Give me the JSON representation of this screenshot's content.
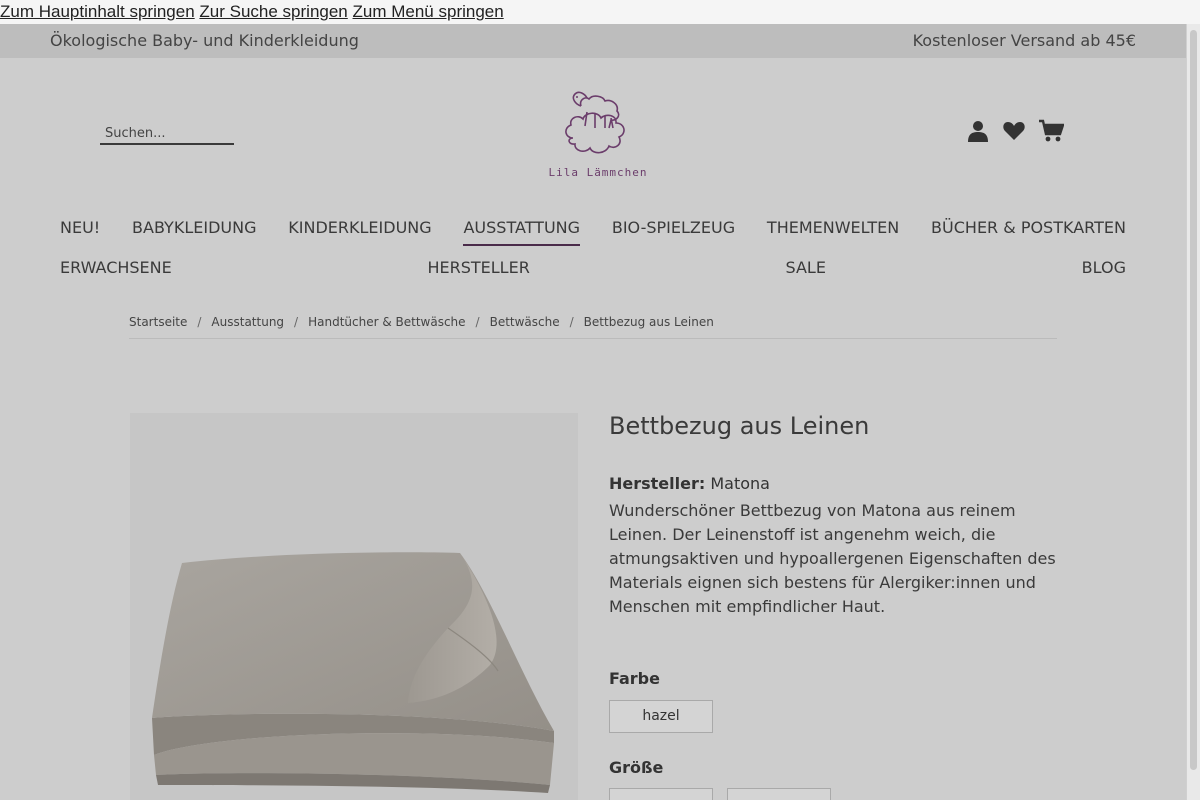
{
  "skip_links": {
    "main": "Zum Hauptinhalt springen",
    "search": "Zur Suche springen",
    "menu": "Zum Menü springen"
  },
  "topbar": {
    "tagline": "Ökologische Baby- und Kinderkleidung",
    "shipping": "Kostenloser Versand ab 45€"
  },
  "header": {
    "search_placeholder": "Suchen...",
    "logo_text": "Lila Lämmchen",
    "icons": [
      "user-icon",
      "heart-icon",
      "cart-icon"
    ]
  },
  "nav": {
    "row1": [
      "NEU!",
      "BABYKLEIDUNG",
      "KINDERKLEIDUNG",
      "AUSSTATTUNG",
      "BIO-SPIELZEUG",
      "THEMENWELTEN",
      "BÜCHER & POSTKARTEN"
    ],
    "row2": [
      "ERWACHSENE",
      "HERSTELLER",
      "SALE",
      "BLOG"
    ],
    "active": "AUSSTATTUNG"
  },
  "breadcrumb": [
    "Startseite",
    "Ausstattung",
    "Handtücher & Bettwäsche",
    "Bettwäsche",
    "Bettbezug aus Leinen"
  ],
  "product": {
    "title": "Bettbezug aus Leinen",
    "maker_label": "Hersteller:",
    "maker": "Matona",
    "description": "Wunderschöner Bettbezug von Matona aus reinem Leinen. Der Leinenstoff ist angenehm weich, die atmungsaktiven und hypoallergenen Eigenschaften des Materials eignen sich bestens für Alergiker:innen und Menschen mit empfindlicher Haut.",
    "color_label": "Farbe",
    "color_option": "hazel",
    "size_label": "Größe"
  },
  "colors": {
    "overlay_bg": "#cdcdcd",
    "topbar_bg": "#bdbdbd",
    "brand": "#6b3d6b"
  }
}
